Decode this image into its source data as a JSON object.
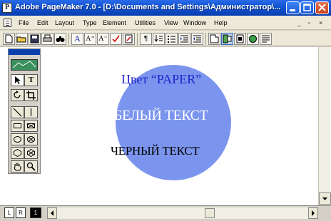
{
  "window": {
    "title": "Adobe PageMaker 7.0 - [D:\\Documents and Settings\\Администратор\\...",
    "app_icon": "P"
  },
  "menu": {
    "items": [
      "File",
      "Edit",
      "Layout",
      "Type",
      "Element",
      "Utilities",
      "View",
      "Window",
      "Help"
    ],
    "mdi_controls": [
      "_",
      "▫",
      "×"
    ]
  },
  "toolbar": {
    "buttons": [
      "new-icon",
      "open-icon",
      "save-icon",
      "print-icon",
      "find-icon",
      "font-size-icon",
      "font-bigger-icon",
      "font-smaller-icon",
      "spell-icon",
      "edit-story-icon",
      "pilcrow-icon",
      "align-icon",
      "bullets-icon",
      "indent-icon",
      "outdent-icon",
      "frame-icon",
      "link-icon",
      "apply-icon",
      "color-icon"
    ],
    "labels": {
      "A": "A",
      "A_up": "A⁺",
      "A_down": "A⁻",
      "pilcrow": "¶"
    }
  },
  "toolbox": {
    "tools": [
      "pointer-tool",
      "text-tool",
      "rotate-tool",
      "crop-tool",
      "line-tool",
      "constrained-line-tool",
      "rectangle-tool",
      "rectangle-frame-tool",
      "ellipse-tool",
      "ellipse-frame-tool",
      "polygon-tool",
      "polygon-frame-tool",
      "hand-tool",
      "zoom-tool"
    ]
  },
  "canvas": {
    "heading": "Цвет “PAPER”",
    "white_text": "БЕЛЫЙ ТЕКСТ",
    "black_text": "ЧЕРНЫЙ ТЕКСТ",
    "circle_color": "#7b95ee",
    "heading_color": "#2222cc"
  },
  "status": {
    "left_page": "L",
    "right_page": "R",
    "current_page": "1"
  }
}
